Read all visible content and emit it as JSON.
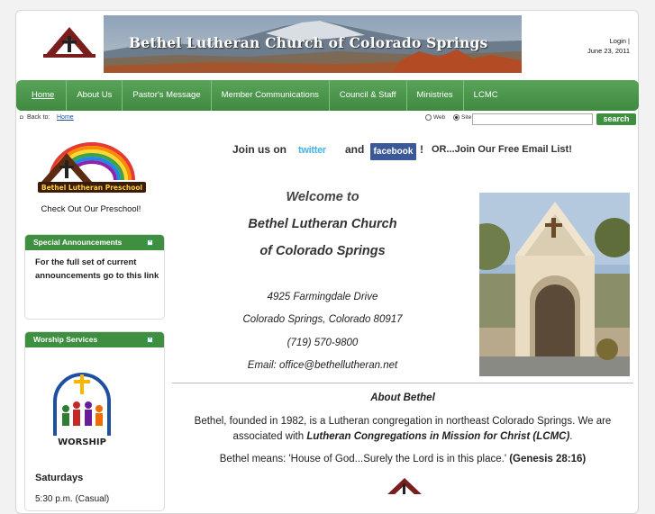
{
  "header": {
    "banner_title": "Bethel Lutheran Church of Colorado Springs",
    "login": "Login |",
    "date": "June 23, 2011"
  },
  "nav": {
    "items": [
      "Home",
      "About Us",
      "Pastor's Message",
      "Member Communications",
      "Council & Staff",
      "Ministries",
      "LCMC"
    ]
  },
  "subbar": {
    "back_label": "Back to:",
    "back_link": "Home",
    "radio_web": "Web",
    "radio_site": "Site",
    "search_button": "search"
  },
  "sidebar": {
    "preschool_logo_text": "Bethel Lutheran Preschool",
    "preschool_caption": "Check Out Our Preschool!",
    "announcements_title": "Special Announcements",
    "announcements_text": "For the full set of current announcements go to this link",
    "worship_title": "Worship Services",
    "worship_logo_text": "WORSHIP",
    "saturdays": "Saturdays",
    "saturday_time": "5:30 p.m. (Casual)"
  },
  "main": {
    "join_us": "Join us on",
    "twitter": "twitter",
    "and": "and",
    "facebook": "facebook",
    "exclaim": "!",
    "or_email": "OR...Join Our Free Email List!",
    "welcome_to": "Welcome to",
    "church_name": "Bethel Lutheran Church",
    "of_city": "of Colorado Springs",
    "address1": "4925 Farmingdale Drive",
    "address2": "Colorado Springs, Colorado 80917",
    "phone": "(719) 570-9800",
    "email": "Email:  office@bethellutheran.net",
    "about_title": "About Bethel",
    "about_p1_a": "Bethel, founded in 1982, is a Lutheran congregation in northeast Colorado Springs.  We are associated with ",
    "about_p1_b": "Lutheran Congregations in Mission for Christ (LCMC)",
    "about_p1_c": ".",
    "about_p2_a": "Bethel means: 'House of God...Surely the Lord is in this place.' ",
    "about_p2_b": "(Genesis 28:16)"
  },
  "colors": {
    "nav_green": "#3e8a3f",
    "facebook_blue": "#3b5998",
    "twitter_blue": "#47b3e4"
  }
}
